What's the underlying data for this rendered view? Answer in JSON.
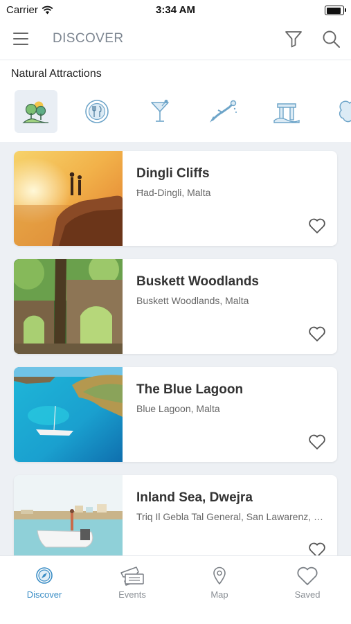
{
  "status_bar": {
    "carrier": "Carrier",
    "time": "3:34 AM"
  },
  "header": {
    "title": "DISCOVER"
  },
  "section": {
    "title": "Natural Attractions"
  },
  "categories": [
    {
      "icon": "trees-icon",
      "selected": true
    },
    {
      "icon": "restaurant-icon",
      "selected": false
    },
    {
      "icon": "cocktail-icon",
      "selected": false
    },
    {
      "icon": "diver-icon",
      "selected": false
    },
    {
      "icon": "ruins-icon",
      "selected": false
    },
    {
      "icon": "cloud-icon",
      "selected": false
    }
  ],
  "places": [
    {
      "name": "Dingli Cliffs",
      "location": "Ħad-Dingli, Malta",
      "saved": false
    },
    {
      "name": "Buskett Woodlands",
      "location": "Buskett Woodlands, Malta",
      "saved": false
    },
    {
      "name": "The Blue Lagoon",
      "location": "Blue Lagoon, Malta",
      "saved": false
    },
    {
      "name": "Inland Sea, Dwejra",
      "location": "Triq Il Gebla Tal General, San Lawarenz, Malta",
      "saved": false
    }
  ],
  "tabs": [
    {
      "label": "Discover",
      "icon": "compass-icon",
      "active": true
    },
    {
      "label": "Events",
      "icon": "ticket-icon",
      "active": false
    },
    {
      "label": "Map",
      "icon": "map-pin-icon",
      "active": false
    },
    {
      "label": "Saved",
      "icon": "heart-icon",
      "active": false
    }
  ],
  "colors": {
    "accent": "#3a8dc5",
    "icon_blue": "#6ea5c9",
    "list_background": "#edf0f4"
  }
}
